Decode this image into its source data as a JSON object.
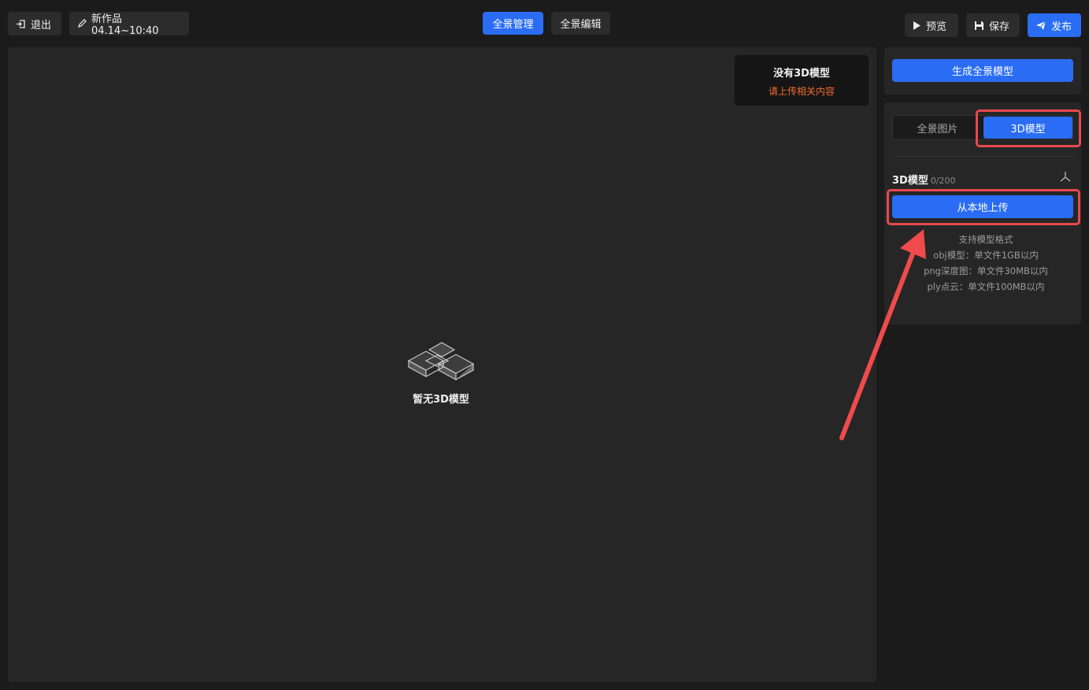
{
  "header": {
    "exit_label": "退出",
    "project_name": "新作品04.14~10:40",
    "tabs": [
      {
        "label": "全景管理",
        "active": true
      },
      {
        "label": "全景编辑",
        "active": false
      }
    ],
    "preview_label": "预览",
    "save_label": "保存",
    "publish_label": "发布"
  },
  "viewport": {
    "notice_title": "没有3D模型",
    "notice_sub": "请上传相关内容",
    "empty_text": "暂无3D模型"
  },
  "sidebar": {
    "generate_label": "生成全景模型",
    "segment": {
      "option_a": "全景图片",
      "option_b": "3D模型",
      "active": "3D模型"
    },
    "section_title": "3D模型",
    "section_count": "0/200",
    "upload_label": "从本地上传",
    "formats": [
      "支持模型格式",
      "obj模型：单文件1GB以内",
      "png深度图：单文件30MB以内",
      "ply点云：单文件100MB以内"
    ]
  },
  "colors": {
    "accent": "#2a6df4",
    "highlight": "#e8484f",
    "warning_text": "#f26b2e",
    "background": "#1b1b1b",
    "panel": "#262626"
  }
}
